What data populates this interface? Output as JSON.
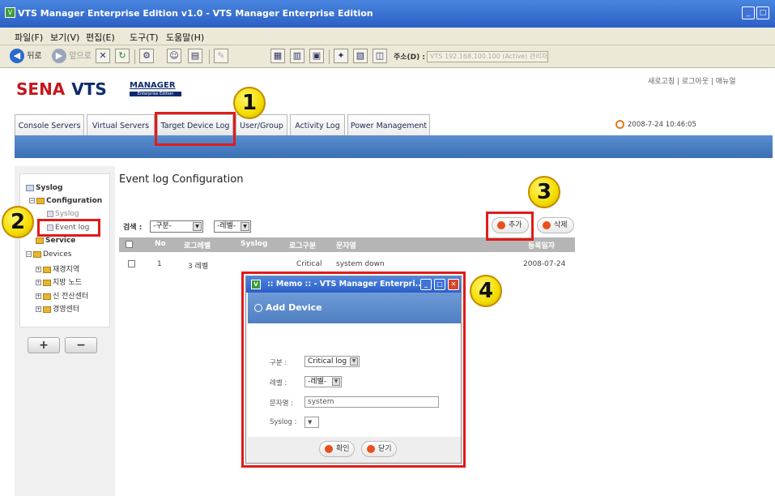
{
  "window": {
    "title": "VTS Manager Enterprise Edition v1.0 - VTS Manager Enterprise Edition",
    "minimize": "_",
    "maximize": "□"
  },
  "menu": [
    "파일(F)",
    "보기(V)",
    "편집(E)",
    "도구(T)",
    "도움말(H)"
  ],
  "toolbar": {
    "back": "뒤로",
    "forward": "앞으로",
    "address_label": "주소(D) :",
    "address_value": "VTS 192.168.100.100 (Active) 관리자",
    "extra_button": "▲"
  },
  "header": {
    "brand": "SENA",
    "product": "VTS",
    "manager_text": "MANAGER",
    "edition_text": "Enterprise Edition",
    "top_links": "새로고침 | 로그아웃 | 매뉴얼",
    "datetime": "2008-7-24  10:46:05"
  },
  "tabs": [
    "Console Servers",
    "Virtual Servers",
    "Target Device Log",
    "User/Group",
    "Activity Log",
    "Power Management"
  ],
  "sidebar": {
    "syslog": "Syslog",
    "configuration": "Configuration",
    "syslog_child": "Syslog",
    "event_log": "Event log",
    "service": "Service",
    "devices": "Devices",
    "device_groups": [
      "재경지역",
      "지방 노드",
      "신 전산센터",
      "경영센터"
    ],
    "add": "+",
    "remove": "−"
  },
  "main": {
    "title": "Event log Configuration",
    "search_label": "검색 :",
    "filter1": "-구분-",
    "filter2": "-레벨-",
    "add_button": "추가",
    "delete_button": "삭제",
    "columns": [
      "No",
      "로그레벨",
      "Syslog",
      "로그구분",
      "문자열",
      "등록일자"
    ],
    "rows": [
      {
        "no": "1",
        "level": "3 레벨",
        "syslog": "",
        "type": "Critical",
        "string": "system down",
        "date": "2008-07-24"
      }
    ]
  },
  "modal": {
    "title": ":: Memo :: - VTS Manager Enterpri...",
    "heading": "Add Device",
    "fields": {
      "type_label": "구분 :",
      "type_value": "Critical log",
      "level_label": "레벨 :",
      "level_value": "-레벨-",
      "string_label": "문자열 :",
      "string_value": "system",
      "syslog_label": "Syslog :"
    },
    "ok": "확인",
    "close": "닫기"
  },
  "callouts": [
    "1",
    "2",
    "3",
    "4"
  ]
}
